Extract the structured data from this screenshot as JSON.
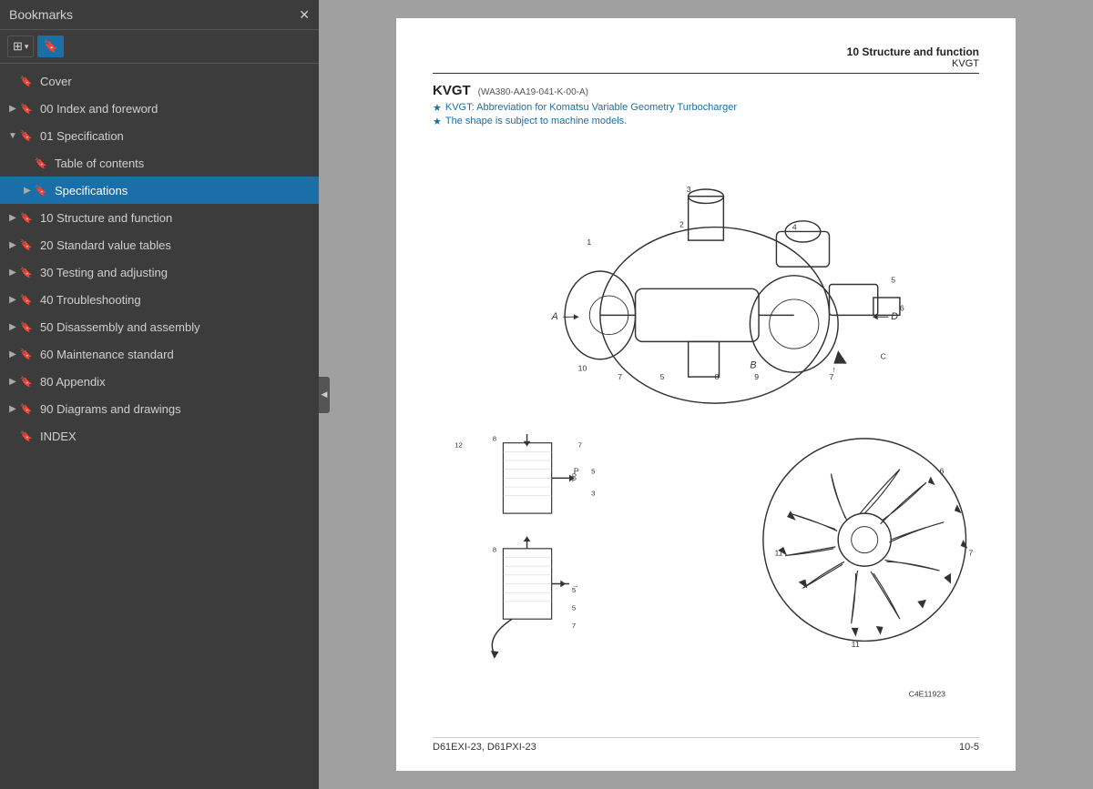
{
  "sidebar": {
    "title": "Bookmarks",
    "close_label": "✕",
    "toolbar": {
      "view_btn_icon": "⊞",
      "view_btn_arrow": "▾",
      "bookmark_btn_icon": "🔖"
    },
    "items": [
      {
        "id": "cover",
        "label": "Cover",
        "indent": 0,
        "expand": "empty",
        "selected": false
      },
      {
        "id": "idx",
        "label": "00 Index and foreword",
        "indent": 0,
        "expand": "closed",
        "selected": false
      },
      {
        "id": "spec",
        "label": "01 Specification",
        "indent": 0,
        "expand": "open",
        "selected": false
      },
      {
        "id": "toc",
        "label": "Table of contents",
        "indent": 1,
        "expand": "empty",
        "selected": false
      },
      {
        "id": "specifications",
        "label": "Specifications",
        "indent": 1,
        "expand": "closed",
        "selected": true
      },
      {
        "id": "struct",
        "label": "10 Structure and function",
        "indent": 0,
        "expand": "closed",
        "selected": false
      },
      {
        "id": "std",
        "label": "20 Standard value tables",
        "indent": 0,
        "expand": "closed",
        "selected": false
      },
      {
        "id": "test",
        "label": "30 Testing and adjusting",
        "indent": 0,
        "expand": "closed",
        "selected": false
      },
      {
        "id": "trouble",
        "label": "40 Troubleshooting",
        "indent": 0,
        "expand": "closed",
        "selected": false
      },
      {
        "id": "disasm",
        "label": "50 Disassembly and assembly",
        "indent": 0,
        "expand": "closed",
        "selected": false
      },
      {
        "id": "maint",
        "label": "60 Maintenance standard",
        "indent": 0,
        "expand": "closed",
        "selected": false
      },
      {
        "id": "append",
        "label": "80 Appendix",
        "indent": 0,
        "expand": "closed",
        "selected": false
      },
      {
        "id": "diag",
        "label": "90 Diagrams and drawings",
        "indent": 0,
        "expand": "closed",
        "selected": false
      },
      {
        "id": "index",
        "label": "INDEX",
        "indent": 0,
        "expand": "empty",
        "selected": false
      }
    ]
  },
  "page": {
    "header_title": "10 Structure and function",
    "header_sub": "KVGT",
    "kvgt_title": "KVGT",
    "kvgt_model": "(WA380-AA19-041-K-00-A)",
    "note1": "KVGT: Abbreviation for Komatsu Variable Geometry Turbocharger",
    "note2": "The shape is subject to machine models.",
    "diagram_alt": "KVGT turbocharger diagram",
    "footer_model": "D61EXI-23, D61PXI-23",
    "footer_page": "10-5",
    "footer_code": "C4E11923"
  },
  "collapse_handle": "◀"
}
